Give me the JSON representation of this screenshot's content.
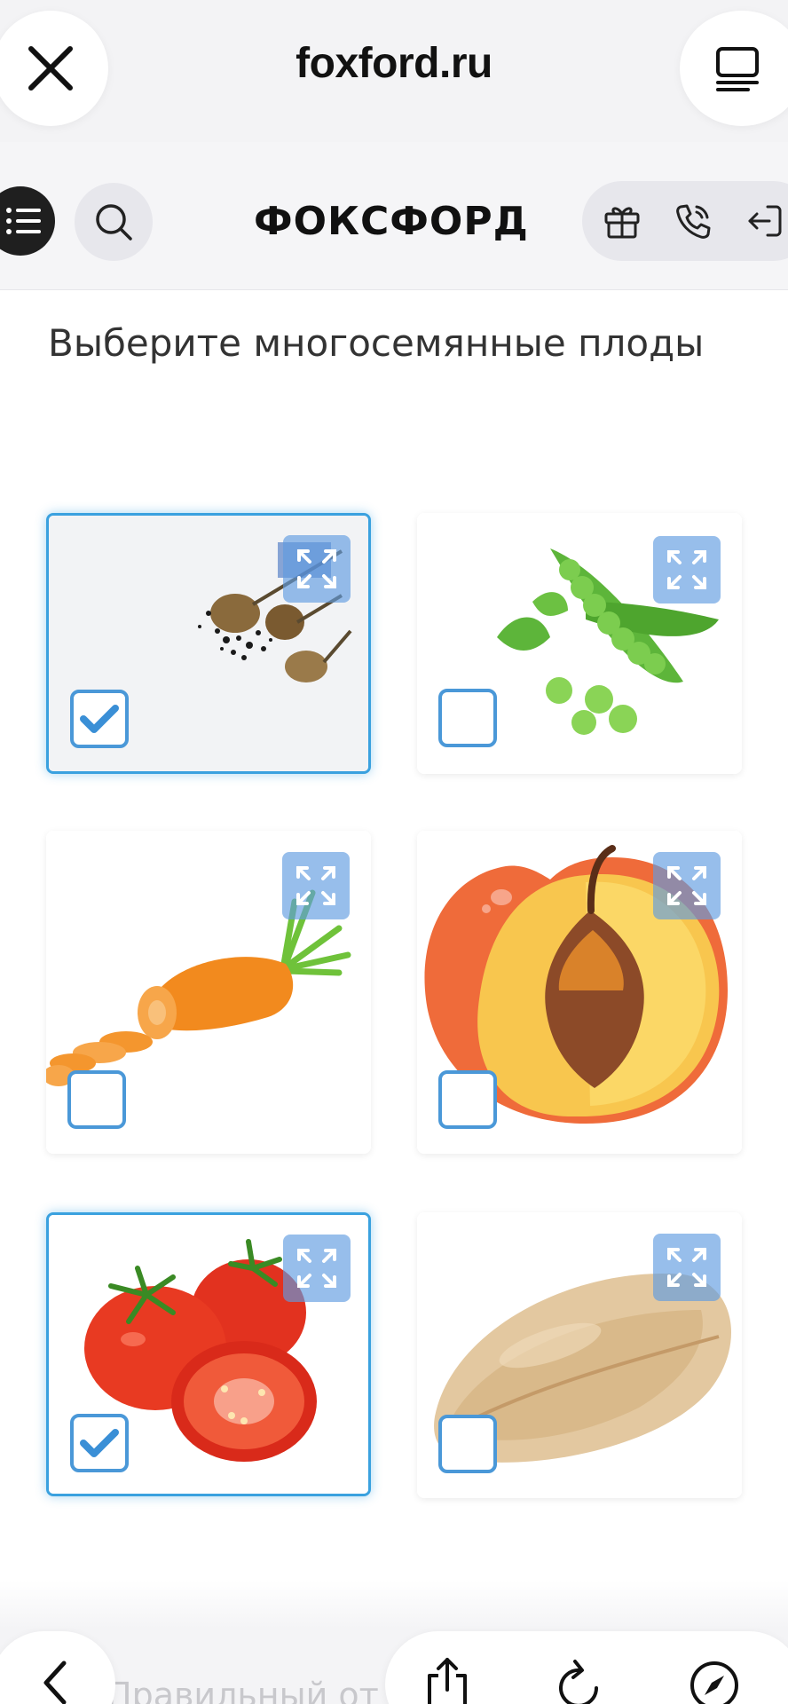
{
  "browser": {
    "url": "foxford.ru",
    "close_icon": "close-icon",
    "tabs_icon": "tabs-icon"
  },
  "header": {
    "logo": "ФОКСФОРД",
    "menu_icon": "list-icon",
    "search_icon": "search-icon",
    "actions": [
      "gift-icon",
      "phone-icon",
      "login-icon"
    ]
  },
  "question": {
    "prompt": "Выберите многосемянные плоды"
  },
  "options": [
    {
      "subject": "poppy seed pods",
      "checked": true
    },
    {
      "subject": "peas",
      "checked": false
    },
    {
      "subject": "carrot",
      "checked": false
    },
    {
      "subject": "peach",
      "checked": false
    },
    {
      "subject": "tomatoes",
      "checked": true
    },
    {
      "subject": "wheat grain",
      "checked": false
    }
  ],
  "bottom_bar": {
    "peek_text": "Правильный от",
    "icons": [
      "back-icon",
      "share-icon",
      "reload-icon",
      "compass-icon"
    ]
  },
  "colors": {
    "accent": "#3aa1df",
    "checkbox": "#4a98d8",
    "expand": "#5f9be1"
  }
}
